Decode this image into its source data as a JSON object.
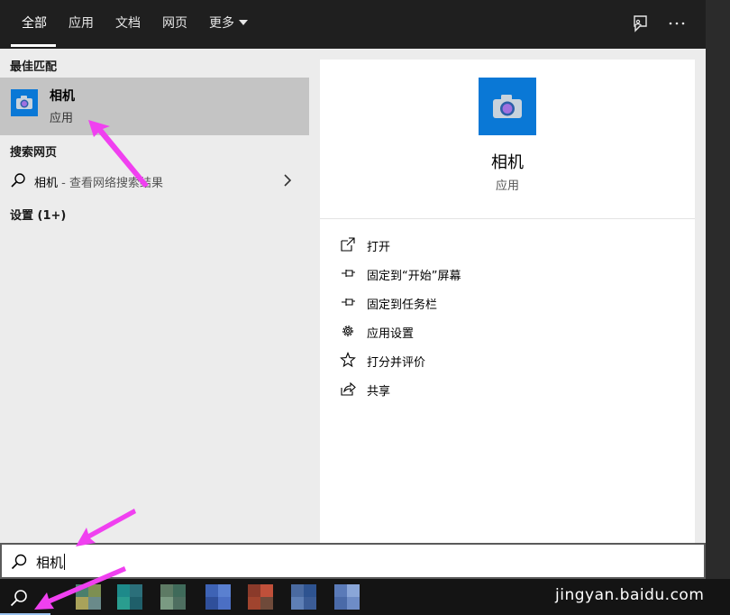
{
  "tabs": [
    {
      "label": "全部",
      "active": true
    },
    {
      "label": "应用"
    },
    {
      "label": "文档"
    },
    {
      "label": "网页"
    },
    {
      "label": "更多"
    }
  ],
  "toolbar_icons": [
    "feedback-icon",
    "more-options-icon"
  ],
  "left": {
    "best_match_label": "最佳匹配",
    "best_match": {
      "name": "相机",
      "type": "应用",
      "icon": "camera-icon"
    },
    "search_web_label": "搜索网页",
    "web_result": {
      "query": "相机",
      "suffix": " - 查看网络搜索结果"
    },
    "settings_label": "设置 (1+)"
  },
  "right": {
    "app_name": "相机",
    "app_type": "应用",
    "actions": [
      {
        "label": "打开",
        "icon": "open-icon"
      },
      {
        "label": "固定到“开始”屏幕",
        "icon": "pin-icon"
      },
      {
        "label": "固定到任务栏",
        "icon": "pin-icon"
      },
      {
        "label": "应用设置",
        "icon": "gear-icon"
      },
      {
        "label": "打分并评价",
        "icon": "star-icon"
      },
      {
        "label": "共享",
        "icon": "share-icon"
      }
    ]
  },
  "search": {
    "value": "相机"
  },
  "watermark": {
    "text": "jingyan.baidu.com"
  },
  "colors": {
    "accent": "#0a78d6",
    "annotation": "#f040f0"
  }
}
